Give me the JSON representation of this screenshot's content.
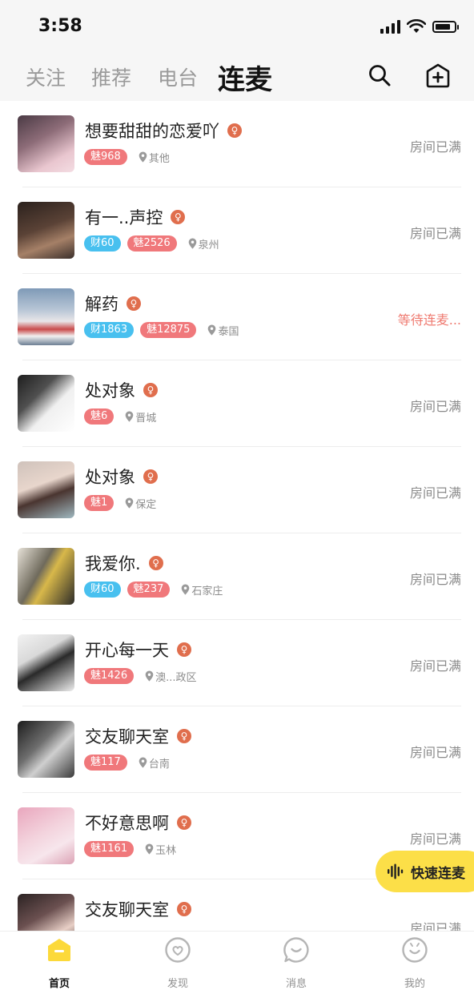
{
  "status_bar": {
    "time": "3:58"
  },
  "header": {
    "tabs": [
      {
        "label": "关注"
      },
      {
        "label": "推荐"
      },
      {
        "label": "电台"
      },
      {
        "label": "连麦"
      }
    ],
    "active_tab": "连麦",
    "icons": [
      "search-icon",
      "add-room-icon"
    ]
  },
  "rooms": [
    {
      "name": "想要甜甜的恋爱吖",
      "gender": "♀",
      "tags": [
        {
          "type": "mei",
          "text": "魅968"
        }
      ],
      "location": "其他",
      "status": "房间已满"
    },
    {
      "name": "有一..声控",
      "gender": "♀",
      "tags": [
        {
          "type": "cai",
          "text": "财60"
        },
        {
          "type": "mei",
          "text": "魅2526"
        }
      ],
      "location": "泉州",
      "status": "房间已满"
    },
    {
      "name": "解药",
      "gender": "♀",
      "tags": [
        {
          "type": "cai",
          "text": "财1863"
        },
        {
          "type": "mei",
          "text": "魅12875"
        }
      ],
      "location": "泰国",
      "status": "等待连麦..."
    },
    {
      "name": "处对象",
      "gender": "♀",
      "tags": [
        {
          "type": "mei",
          "text": "魅6"
        }
      ],
      "location": "晋城",
      "status": "房间已满"
    },
    {
      "name": "处对象",
      "gender": "♀",
      "tags": [
        {
          "type": "mei",
          "text": "魅1"
        }
      ],
      "location": "保定",
      "status": "房间已满"
    },
    {
      "name": "我爱你.",
      "gender": "♀",
      "tags": [
        {
          "type": "cai",
          "text": "财60"
        },
        {
          "type": "mei",
          "text": "魅237"
        }
      ],
      "location": "石家庄",
      "status": "房间已满"
    },
    {
      "name": "开心每一天",
      "gender": "♀",
      "tags": [
        {
          "type": "mei",
          "text": "魅1426"
        }
      ],
      "location": "澳...政区",
      "status": "房间已满"
    },
    {
      "name": "交友聊天室",
      "gender": "♀",
      "tags": [
        {
          "type": "mei",
          "text": "魅117"
        }
      ],
      "location": "台南",
      "status": "房间已满"
    },
    {
      "name": "不好意思啊",
      "gender": "♀",
      "tags": [
        {
          "type": "mei",
          "text": "魅1161"
        }
      ],
      "location": "玉林",
      "status": "房间已满"
    },
    {
      "name": "交友聊天室",
      "gender": "♀",
      "tags": [],
      "location": "",
      "status": "房间已满"
    }
  ],
  "fab": {
    "label": "快速连麦",
    "icon": "sound-wave-icon"
  },
  "tabbar": {
    "items": [
      {
        "label": "首页",
        "icon": "home-icon"
      },
      {
        "label": "发现",
        "icon": "discover-heart-icon"
      },
      {
        "label": "消息",
        "icon": "message-icon"
      },
      {
        "label": "我的",
        "icon": "profile-icon"
      }
    ],
    "active": "首页"
  },
  "colors": {
    "accent": "#fcdf48",
    "cai_tag": "#48c0ef",
    "mei_tag": "#f0787b",
    "gender": "#e06e4d",
    "waiting": "#ef7a70"
  }
}
